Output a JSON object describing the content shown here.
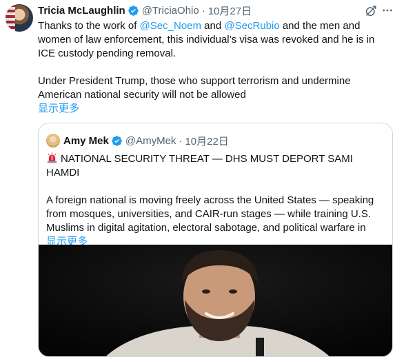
{
  "tweet": {
    "author_name": "Tricia McLaughlin",
    "handle": "@TriciaOhio",
    "separator": "·",
    "date": "10月27日",
    "text_part1": "Thanks to the work of ",
    "mention1": "@Sec_Noem",
    "text_part2": " and ",
    "mention2": "@SecRubio",
    "text_part3": " and the men and women of law enforcement, this individual’s visa was revoked and he is in ICE custody pending removal.",
    "paragraph2": "Under President Trump, those who support terrorism and undermine American national security will not be allowed",
    "show_more": "显示更多",
    "icons": [
      "grok-icon",
      "more-icon",
      "verified-badge-icon"
    ]
  },
  "quote": {
    "author_name": "Amy Mek",
    "handle": "@AmyMek",
    "separator": "·",
    "date": "10月22日",
    "headline": "NATIONAL SECURITY THREAT — DHS MUST DEPORT SAMI HAMDI",
    "body": "A foreign national is moving freely across the United States — speaking from mosques, universities, and CAIR-run stages — while training U.S. Muslims in digital agitation, electoral sabotage, and political warfare in",
    "show_more": "显示更多",
    "icons": [
      "siren-icon",
      "verified-badge-icon"
    ]
  },
  "colors": {
    "link": "#1d9bf0",
    "muted": "#536471",
    "text": "#0f1419",
    "border": "#cfd9de",
    "verified": "#1d9bf0"
  }
}
